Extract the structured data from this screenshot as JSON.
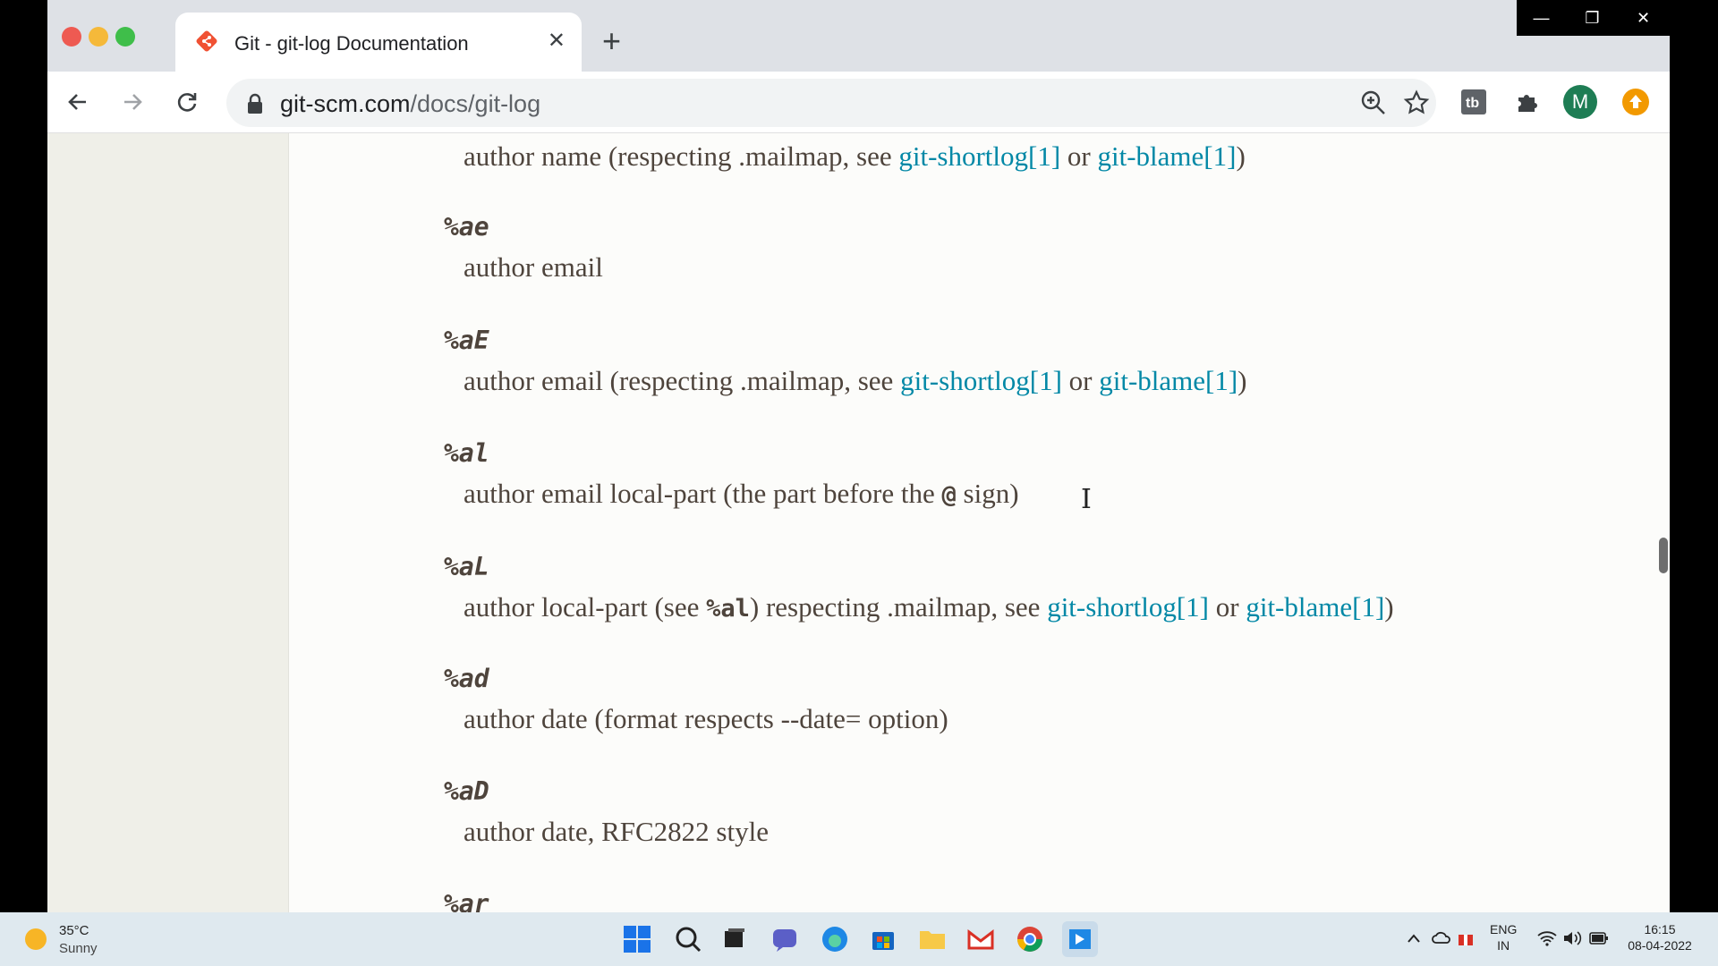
{
  "browser": {
    "tab_title": "Git - git-log Documentation",
    "tab_close": "✕",
    "new_tab": "+",
    "url_host": "git-scm.com",
    "url_path": "/docs/git-log",
    "avatar_letter": "M",
    "colors": {
      "accent": "#0388a6",
      "text": "#4e443c",
      "tab_bg": "#dee1e6"
    }
  },
  "doc": {
    "link_shortlog": "git-shortlog[1]",
    "link_blame": "git-blame[1]",
    "entries": [
      {
        "desc_pre": "author name (respecting .mailmap, see ",
        "mid": " or ",
        "post": ")"
      },
      {
        "code": "%ae",
        "desc": "author email"
      },
      {
        "code": "%aE",
        "desc_pre": "author email (respecting .mailmap, see ",
        "mid": " or ",
        "post": ")"
      },
      {
        "code": "%al",
        "desc_pre": "author email local-part (the part before the ",
        "at": "@",
        "post": " sign)"
      },
      {
        "code": "%aL",
        "desc_pre": "author local-part (see ",
        "inline_code": "%al",
        "desc_mid": ") respecting .mailmap, see ",
        "mid": " or ",
        "post": ")"
      },
      {
        "code": "%ad",
        "desc": "author date (format respects --date= option)"
      },
      {
        "code": "%aD",
        "desc": "author date, RFC2822 style"
      },
      {
        "code": "%ar"
      }
    ]
  },
  "taskbar": {
    "weather_temp": "35°C",
    "weather_cond": "Sunny",
    "lang_top": "ENG",
    "lang_bottom": "IN",
    "time": "16:15",
    "date": "08-04-2022"
  }
}
